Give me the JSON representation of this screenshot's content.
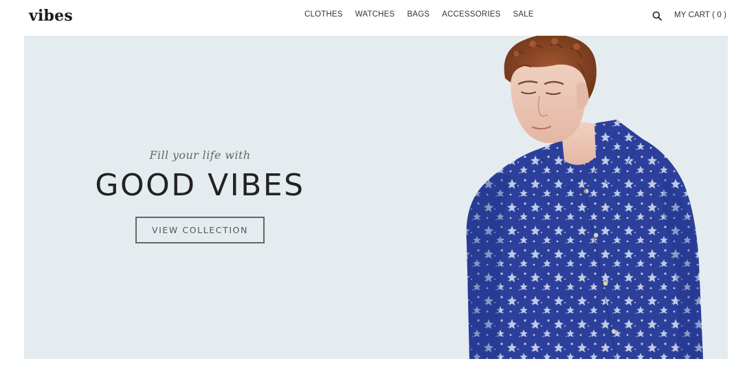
{
  "brand": {
    "logo_text": "vibes"
  },
  "nav": {
    "items": [
      {
        "label": "CLOTHES"
      },
      {
        "label": "WATCHES"
      },
      {
        "label": "BAGS"
      },
      {
        "label": "ACCESSORIES"
      },
      {
        "label": "SALE"
      }
    ]
  },
  "header": {
    "search_icon": "search-icon",
    "cart_label": "MY CART ( 0 )"
  },
  "hero": {
    "kicker": "Fill your life with",
    "title": "GOOD VIBES",
    "cta_label": "VIEW COLLECTION",
    "image": "male model in blue floral shirt",
    "colors": {
      "background": "#e5ecef",
      "shirt": "#2a3f9a",
      "text": "#222222"
    }
  }
}
